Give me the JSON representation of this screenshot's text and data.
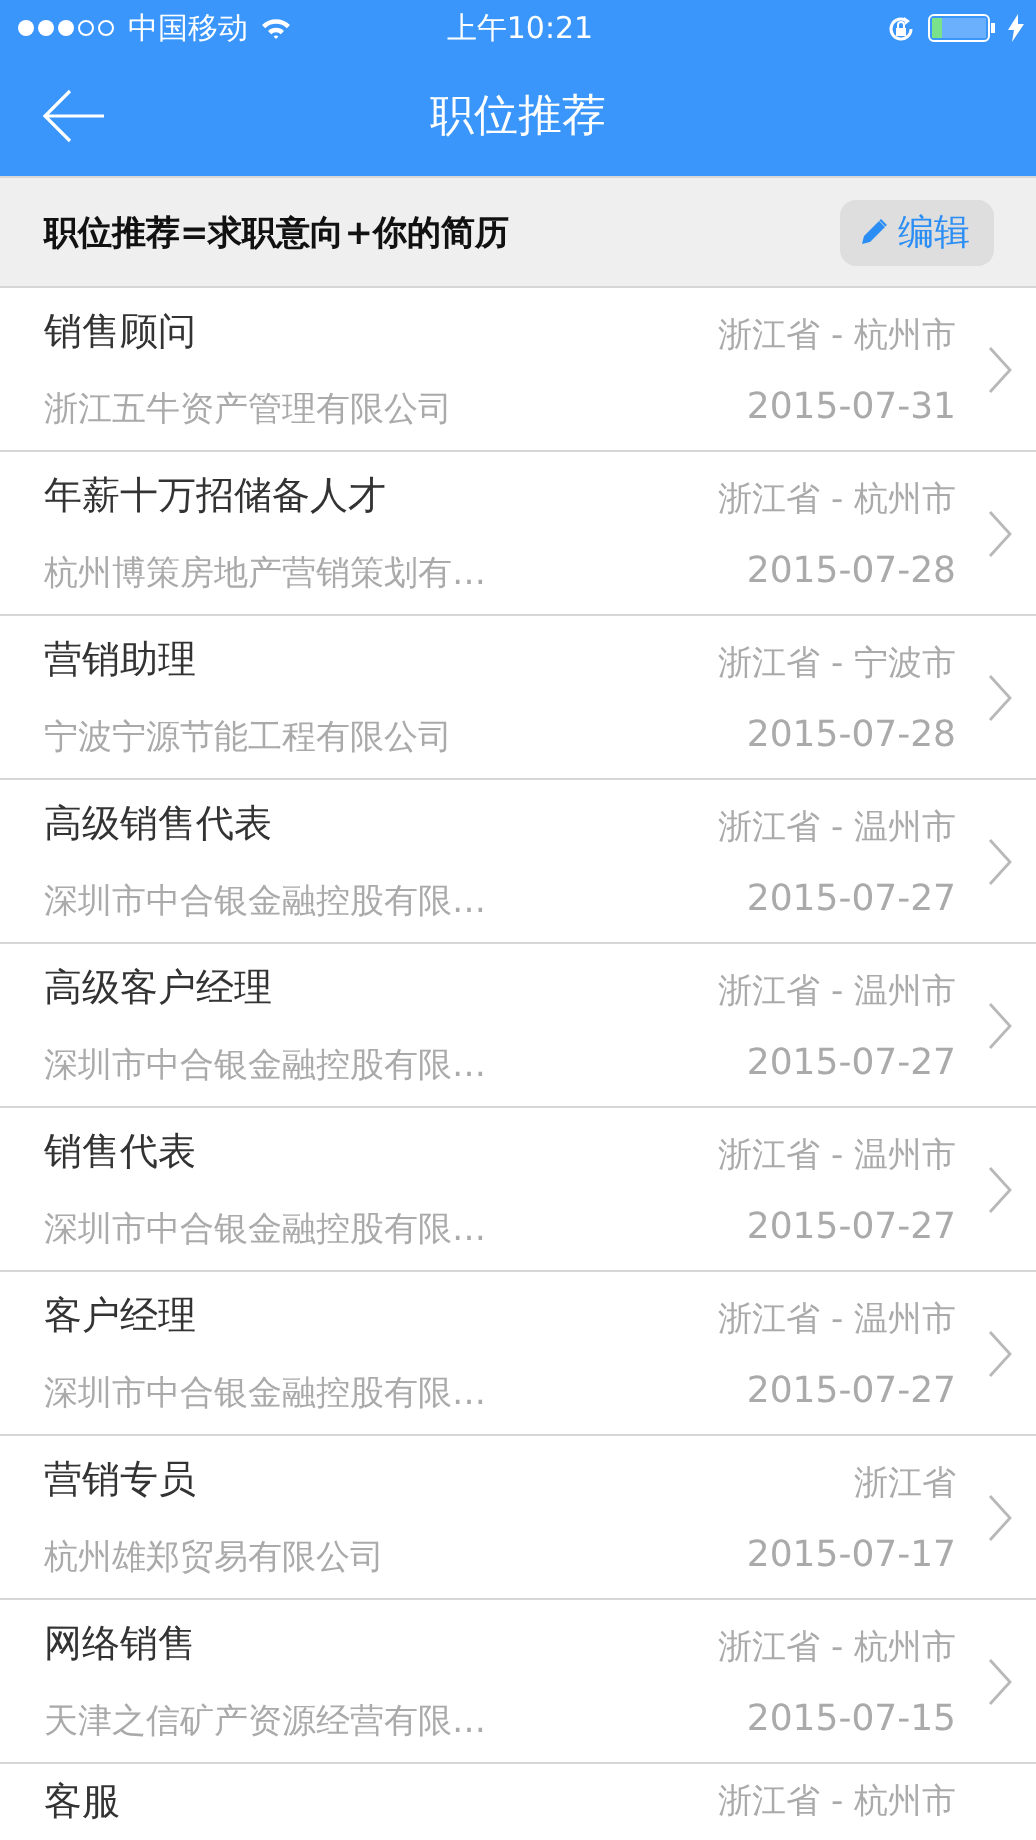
{
  "status_bar": {
    "carrier": "中国移动",
    "time": "上午10:21"
  },
  "nav": {
    "title": "职位推荐"
  },
  "info_bar": {
    "text": "职位推荐=求职意向+你的简历",
    "edit_button": "编辑"
  },
  "jobs": [
    {
      "title": "销售顾问",
      "company": "浙江五牛资产管理有限公司",
      "location": "浙江省 - 杭州市",
      "date": "2015-07-31"
    },
    {
      "title": "年薪十万招储备人才",
      "company": "杭州博策房地产营销策划有…",
      "location": "浙江省 - 杭州市",
      "date": "2015-07-28"
    },
    {
      "title": "营销助理",
      "company": "宁波宁源节能工程有限公司",
      "location": "浙江省 - 宁波市",
      "date": "2015-07-28"
    },
    {
      "title": "高级销售代表",
      "company": "深圳市中合银金融控股有限…",
      "location": "浙江省 - 温州市",
      "date": "2015-07-27"
    },
    {
      "title": "高级客户经理",
      "company": "深圳市中合银金融控股有限…",
      "location": "浙江省 - 温州市",
      "date": "2015-07-27"
    },
    {
      "title": "销售代表",
      "company": "深圳市中合银金融控股有限…",
      "location": "浙江省 - 温州市",
      "date": "2015-07-27"
    },
    {
      "title": "客户经理",
      "company": "深圳市中合银金融控股有限…",
      "location": "浙江省 - 温州市",
      "date": "2015-07-27"
    },
    {
      "title": "营销专员",
      "company": "杭州雄郑贸易有限公司",
      "location": "浙江省",
      "date": "2015-07-17"
    },
    {
      "title": "网络销售",
      "company": "天津之信矿产资源经营有限…",
      "location": "浙江省 - 杭州市",
      "date": "2015-07-15"
    },
    {
      "title": "客服",
      "location": "浙江省 - 杭州市"
    }
  ]
}
